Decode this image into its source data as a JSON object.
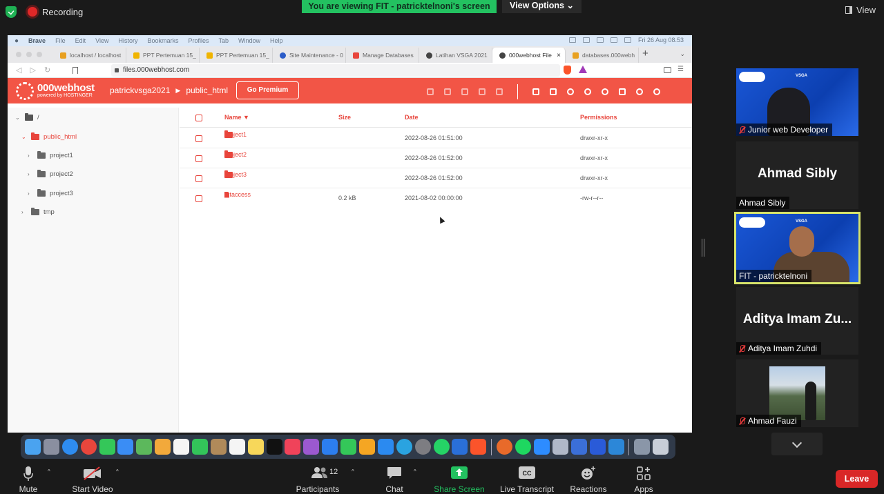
{
  "zoom": {
    "recording_label": "Recording",
    "viewing_banner": "You are viewing FIT - patricktelnoni's screen",
    "view_options_label": "View Options ⌄",
    "view_label": "View",
    "colors": {
      "banner": "#23c160",
      "leave": "#d92727",
      "accent_active": "#d7e36a"
    }
  },
  "mac_menu": {
    "app": "Brave",
    "items": [
      "File",
      "Edit",
      "View",
      "History",
      "Bookmarks",
      "Profiles",
      "Tab",
      "Window",
      "Help"
    ],
    "clock": "Fri 26 Aug  08.53"
  },
  "browser": {
    "tabs": [
      {
        "label": "localhost / localhost",
        "icon_color": "#e8a020"
      },
      {
        "label": "PPT Pertemuan 15_",
        "icon_color": "#f0b400"
      },
      {
        "label": "PPT Pertemuan 15_",
        "icon_color": "#f0b400"
      },
      {
        "label": "Site Maintenance - 0",
        "icon_color": "#2b5cc8"
      },
      {
        "label": "Manage Databases",
        "icon_color": "#e8453c"
      },
      {
        "label": "Latihan VSGA 2021",
        "icon_color": "#444444"
      },
      {
        "label": "000webhost File",
        "icon_color": "#444444",
        "active": true
      },
      {
        "label": "databases.000webh",
        "icon_color": "#e8a020"
      }
    ],
    "url": "files.000webhost.com"
  },
  "app": {
    "brand": "000webhost",
    "brand_sub": "powered by HOSTINGER",
    "breadcrumb": [
      "patrickvsga2021",
      "public_html"
    ],
    "premium_label": "Go Premium",
    "header_color": "#f25546"
  },
  "tree": {
    "root": "/",
    "public_html": "public_html",
    "children": [
      "project1",
      "project2",
      "project3"
    ],
    "tmp": "tmp"
  },
  "table": {
    "headers": {
      "name": "Name ▼",
      "size": "Size",
      "date": "Date",
      "permissions": "Permissions"
    },
    "rows": [
      {
        "name": "project1",
        "size": "",
        "date": "2022-08-26 01:51:00",
        "perm": "drwxr-xr-x"
      },
      {
        "name": "project2",
        "size": "",
        "date": "2022-08-26 01:52:00",
        "perm": "drwxr-xr-x"
      },
      {
        "name": "project3",
        "size": "",
        "date": "2022-08-26 01:52:00",
        "perm": "drwxr-xr-x"
      },
      {
        "name": ".htaccess",
        "size": "0.2 kB",
        "date": "2021-08-02 00:00:00",
        "perm": "-rw-r--r--"
      }
    ]
  },
  "participants": {
    "tiles": [
      {
        "label": "Junior web Developer",
        "muted": true
      },
      {
        "label": "Ahmad Sibly",
        "big": "Ahmad Sibly",
        "muted": false
      },
      {
        "label": "FIT - patricktelnoni",
        "muted": false
      },
      {
        "label": "Aditya Imam Zuhdi",
        "big": "Aditya Imam Zu...",
        "muted": true
      },
      {
        "label": "Ahmad Fauzi",
        "muted": true
      }
    ],
    "vsga_text": "VSGA"
  },
  "toolbar": {
    "mute": "Mute",
    "video": "Start Video",
    "participants": "Participants",
    "participant_count": "12",
    "chat": "Chat",
    "share": "Share Screen",
    "transcript": "Live Transcript",
    "reactions": "Reactions",
    "apps": "Apps",
    "leave": "Leave"
  }
}
